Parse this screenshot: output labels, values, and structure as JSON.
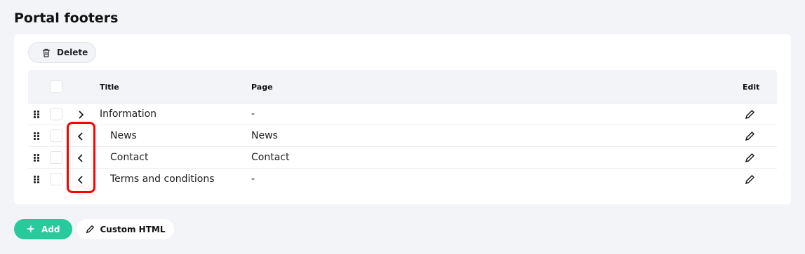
{
  "page": {
    "title": "Portal footers"
  },
  "toolbar": {
    "delete_label": "Delete",
    "delete_icon": "trash-icon"
  },
  "table": {
    "headers": {
      "title": "Title",
      "page": "Page",
      "edit": "Edit"
    },
    "rows": [
      {
        "title": "Information",
        "page": "-",
        "chevron": "chevron-right-icon",
        "indent": false
      },
      {
        "title": "News",
        "page": "News",
        "chevron": "chevron-left-icon",
        "indent": true
      },
      {
        "title": "Contact",
        "page": "Contact",
        "chevron": "chevron-left-icon",
        "indent": true
      },
      {
        "title": "Terms and conditions",
        "page": "-",
        "chevron": "chevron-left-icon",
        "indent": true
      }
    ]
  },
  "actions": {
    "add_label": "Add",
    "custom_html_label": "Custom HTML"
  },
  "colors": {
    "accent": "#28c99a",
    "highlight": "#ff0000",
    "background": "#f3f4f8"
  }
}
